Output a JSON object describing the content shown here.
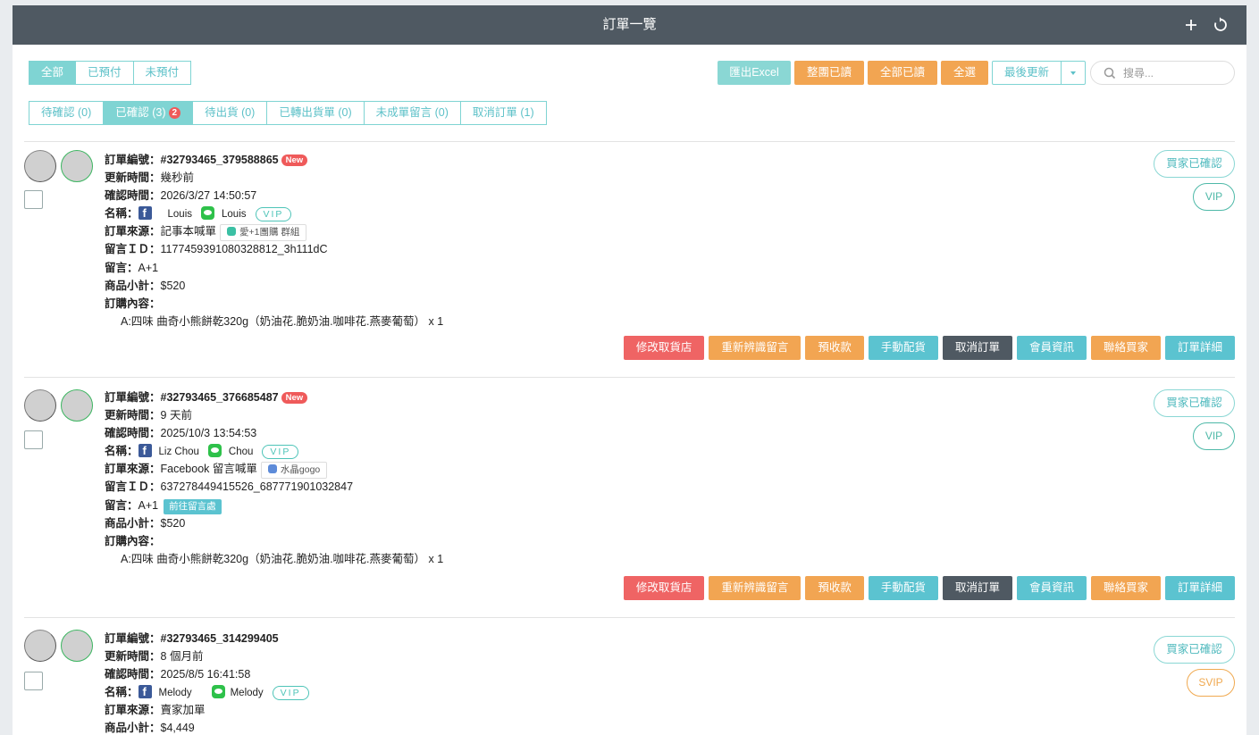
{
  "header": {
    "title": "訂單一覽",
    "plus_icon": "plus-icon",
    "refresh_icon": "refresh-icon"
  },
  "pay_filter": [
    "全部",
    "已預付",
    "未預付"
  ],
  "pay_filter_active": 0,
  "status_tabs": [
    {
      "label": "待確認 (0)",
      "badge": ""
    },
    {
      "label": "已確認 (3)",
      "badge": "2"
    },
    {
      "label": "待出貨 (0)",
      "badge": ""
    },
    {
      "label": "已轉出貨單 (0)",
      "badge": ""
    },
    {
      "label": "未成單留言 (0)",
      "badge": ""
    },
    {
      "label": "取消訂單 (1)",
      "badge": ""
    }
  ],
  "status_active": 1,
  "toolbar": {
    "export_label": "匯出Excel",
    "mark_page_read": "整團已讀",
    "mark_all_read": "全部已讀",
    "select_all": "全選",
    "sort_label": "最後更新",
    "search_placeholder": "搜尋..."
  },
  "labels": {
    "order_no": "訂單編號：",
    "updated": "更新時間：",
    "confirmed": "確認時間：",
    "name": "名稱：",
    "source": "訂單來源：",
    "comment_id": "留言ＩＤ：",
    "comment": "留言：",
    "subtotal": "商品小計：",
    "content": "訂購內容：",
    "new_badge": "New",
    "vip_pill": "VIP",
    "buyer_confirmed": "買家已確認",
    "go_to_comment": "前往留言處"
  },
  "actions": [
    "修改取貨店",
    "重新辨識留言",
    "預收款",
    "手動配貨",
    "取消訂單",
    "會員資訊",
    "聯絡買家",
    "訂單詳細"
  ],
  "orders": [
    {
      "order_no": "#32793465_379588865",
      "is_new": true,
      "updated": "幾秒前",
      "confirmed": "2026/3/27 14:50:57",
      "fb_name": "Louis",
      "line_name": "Louis",
      "source": "記事本喊單",
      "source_tag": "愛+1團購 群組",
      "source_tag_type": "line",
      "comment_id": "1177459391080328812_3h111dC",
      "comment": "A+1",
      "has_go_link": false,
      "subtotal": "$520",
      "content": "A:四味 曲奇小熊餅乾320g（奶油花.脆奶油.咖啡花.燕麥葡萄） x 1",
      "level": "VIP"
    },
    {
      "order_no": "#32793465_376685487",
      "is_new": true,
      "updated": "9 天前",
      "confirmed": "2025/10/3 13:54:53",
      "fb_name": "Liz Chou",
      "line_name": "Chou",
      "source": "Facebook 留言喊單",
      "source_tag": "水晶gogo",
      "source_tag_type": "fb",
      "comment_id": "637278449415526_687771901032847",
      "comment": "A+1",
      "has_go_link": true,
      "subtotal": "$520",
      "content": "A:四味 曲奇小熊餅乾320g（奶油花.脆奶油.咖啡花.燕麥葡萄） x 1",
      "level": "VIP"
    },
    {
      "order_no": "#32793465_314299405",
      "is_new": false,
      "updated": "8 個月前",
      "confirmed": "2025/8/5 16:41:58",
      "fb_name": "Melody",
      "line_name": "Melody",
      "source": "賣家加單",
      "source_tag": "",
      "source_tag_type": "",
      "comment_id": "",
      "comment": "",
      "has_go_link": false,
      "subtotal": "$4,449",
      "content": "",
      "level": "SVIP"
    }
  ]
}
